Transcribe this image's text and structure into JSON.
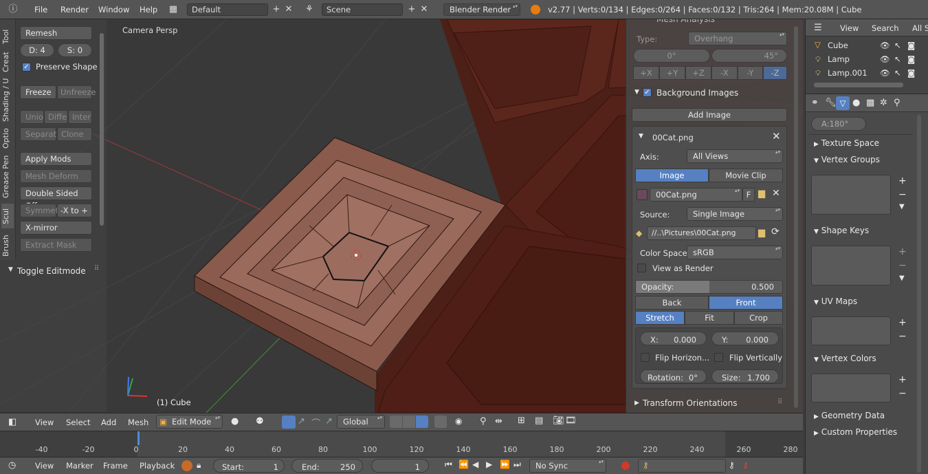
{
  "topbar": {
    "menus": [
      "File",
      "Render",
      "Window",
      "Help"
    ],
    "layout": "Default",
    "scene": "Scene",
    "engine": "Blender Render",
    "stats": "v2.77 | Verts:0/134 | Edges:0/264 | Faces:0/132 | Tris:264 | Mem:20.08M | Cube"
  },
  "toolshelf": {
    "tabs": [
      "Tool",
      "Creat",
      "Shading / U",
      "Optio",
      "Grease Pen",
      "Scul",
      "Brush"
    ],
    "remesh": "Remesh",
    "d_label": "D: 4",
    "s_label": "S:  0",
    "preserve_shape": "Preserve Shape",
    "freeze": "Freeze",
    "unfreeze": "Unfreeze",
    "union": "Unio",
    "diff": "Diffe",
    "inter": "Inter",
    "separate": "Separat",
    "clone": "Clone",
    "apply_mods": "Apply Mods",
    "mesh_deform": "Mesh Deform",
    "double_sided": "Double Sided Off",
    "symmet": "Symmet",
    "x_to": "-X to +",
    "x_mirror": "X-mirror",
    "extract_mask": "Extract Mask",
    "toggle_editmode": "Toggle Editmode"
  },
  "viewport": {
    "label": "Camera Persp",
    "object_label": "(1) Cube"
  },
  "props": {
    "mesh_analysis": "Mesh Analysis",
    "type_label": "Type:",
    "type_value": "Overhang",
    "min": "0°",
    "max": "45°",
    "axes": [
      "+X",
      "+Y",
      "+Z",
      "-X",
      "-Y",
      "-Z"
    ],
    "bg_images": "Background Images",
    "add_image": "Add Image",
    "image_name": "00Cat.png",
    "axis_label": "Axis:",
    "axis_value": "All Views",
    "image_tab": "Image",
    "movie_tab": "Movie Clip",
    "file_name": "00Cat.png",
    "f_label": "F",
    "source_label": "Source:",
    "source_value": "Single Image",
    "path": "//..\\Pictures\\00Cat.png",
    "color_space_label": "Color Space:",
    "color_space_value": "sRGB",
    "view_as_render": "View as Render",
    "opacity_label": "Opacity:",
    "opacity_value": "0.500",
    "back": "Back",
    "front": "Front",
    "stretch": "Stretch",
    "fit": "Fit",
    "crop": "Crop",
    "x_label": "X:",
    "x_value": "0.000",
    "y_label": "Y:",
    "y_value": "0.000",
    "flip_h": "Flip Horizon...",
    "flip_v": "Flip Vertically",
    "rotation_label": "Rotation:",
    "rotation_value": "0°",
    "size_label": "Size:",
    "size_value": "1.700",
    "transform_orient": "Transform Orientations"
  },
  "outliner": {
    "view": "View",
    "search": "Search",
    "all_scenes": "All Sc",
    "items": [
      "Cube",
      "Lamp",
      "Lamp.001"
    ]
  },
  "propeditor": {
    "angle": "A:180°",
    "panels": [
      "Texture Space",
      "Vertex Groups",
      "Shape Keys",
      "UV Maps",
      "Vertex Colors",
      "Geometry Data",
      "Custom Properties"
    ]
  },
  "viewheader": {
    "view": "View",
    "select": "Select",
    "add": "Add",
    "mesh": "Mesh",
    "mode": "Edit Mode",
    "orientation": "Global"
  },
  "timeline": {
    "ticks": [
      "-40",
      "-20",
      "0",
      "20",
      "40",
      "60",
      "80",
      "100",
      "120",
      "140",
      "160",
      "180",
      "200",
      "220",
      "240",
      "260",
      "280"
    ]
  },
  "tlheader": {
    "view": "View",
    "marker": "Marker",
    "frame": "Frame",
    "playback": "Playback",
    "start_label": "Start:",
    "start_value": "1",
    "end_label": "End:",
    "end_value": "250",
    "current": "1",
    "sync": "No Sync"
  }
}
